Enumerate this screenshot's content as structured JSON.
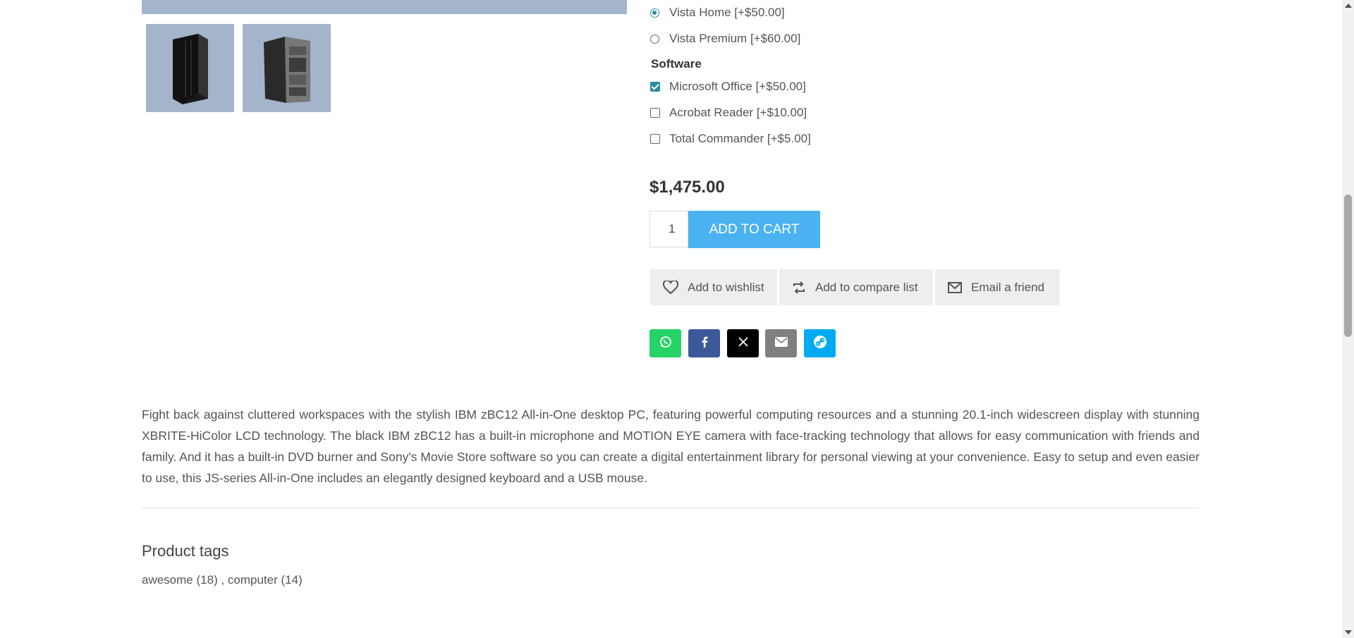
{
  "gallery": {
    "main_image_alt": "IBM zBC12 product image",
    "thumbnails": [
      "thumbnail-front",
      "thumbnail-open"
    ]
  },
  "os_options": [
    {
      "label": "Vista Home [+$50.00]",
      "selected": true
    },
    {
      "label": "Vista Premium [+$60.00]",
      "selected": false
    }
  ],
  "software": {
    "label": "Software",
    "options": [
      {
        "label": "Microsoft Office [+$50.00]",
        "checked": true
      },
      {
        "label": "Acrobat Reader [+$10.00]",
        "checked": false
      },
      {
        "label": "Total Commander [+$5.00]",
        "checked": false
      }
    ]
  },
  "price": "$1,475.00",
  "cart": {
    "quantity": "1",
    "add_label": "ADD TO CART"
  },
  "actions": {
    "wishlist": "Add to wishlist",
    "compare": "Add to compare list",
    "email": "Email a friend"
  },
  "share": [
    {
      "name": "whatsapp-icon",
      "color": "#25d366"
    },
    {
      "name": "facebook-icon",
      "color": "#3b5998"
    },
    {
      "name": "x-icon",
      "color": "#000000"
    },
    {
      "name": "email-icon",
      "color": "#7f7f7f"
    },
    {
      "name": "link-icon",
      "color": "#00aaf1"
    }
  ],
  "description": "Fight back against cluttered workspaces with the stylish IBM zBC12 All-in-One desktop PC, featuring powerful computing resources and a stunning 20.1-inch widescreen display with stunning XBRITE-HiColor LCD technology. The black IBM zBC12 has a built-in microphone and MOTION EYE camera with face-tracking technology that allows for easy communication with friends and family. And it has a built-in DVD burner and Sony's Movie Store software so you can create a digital entertainment library for personal viewing at your convenience. Easy to setup and even easier to use, this JS-series All-in-One includes an elegantly designed keyboard and a USB mouse.",
  "tags": {
    "title": "Product tags",
    "items": [
      {
        "label": "awesome",
        "count": "(18)"
      },
      {
        "label": "computer",
        "count": "(14)"
      }
    ],
    "separator": " , "
  },
  "colors": {
    "accent": "#4ab2f1",
    "checked": "#2b8ca0",
    "image_bg": "#a3b4cb"
  }
}
